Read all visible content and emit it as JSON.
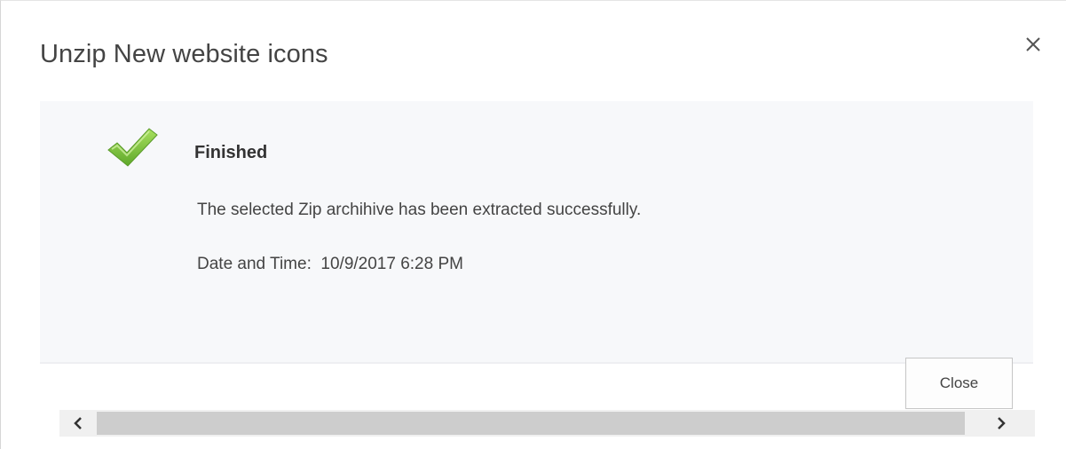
{
  "dialog": {
    "title": "Unzip New website icons",
    "close_icon": "close-icon"
  },
  "status": {
    "icon": "checkmark-icon",
    "title": "Finished",
    "message": "The selected Zip archihive has been extracted successfully.",
    "datetime_label": "Date and Time:",
    "datetime_value": "10/9/2017 6:28 PM"
  },
  "footer": {
    "close_label": "Close"
  },
  "scrollbar": {
    "left_icon": "chevron-left-icon",
    "right_icon": "chevron-right-icon"
  },
  "colors": {
    "check_green": "#7dc243",
    "panel_bg": "#f7f8fa"
  }
}
